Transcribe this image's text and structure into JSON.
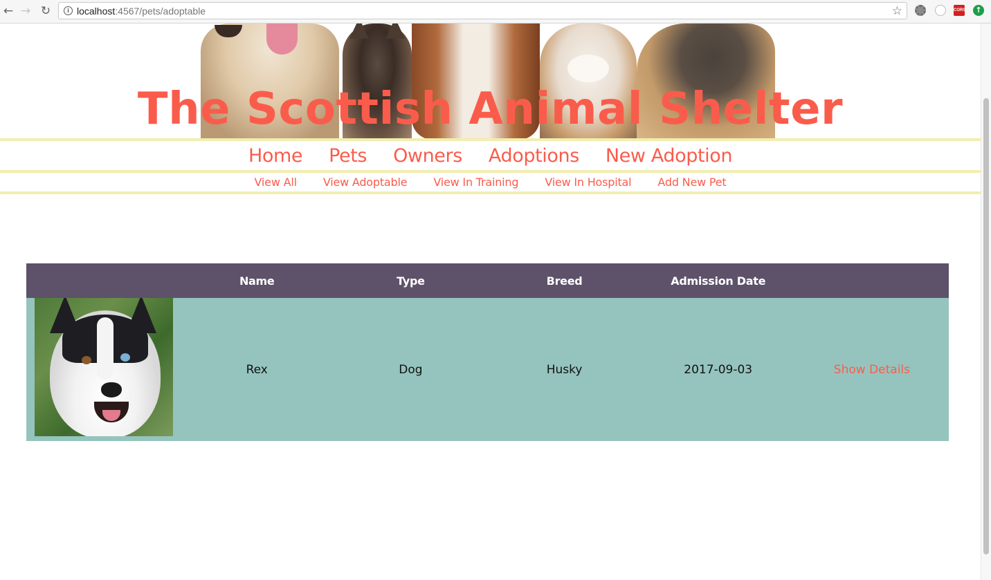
{
  "browser": {
    "url_host": "localhost",
    "url_path": ":4567/pets/adoptable",
    "extensions": [
      "gear-icon",
      "circle-icon",
      "cors-icon",
      "update-icon"
    ],
    "cors_label": "CORS"
  },
  "header": {
    "title": "The Scottish Animal Shelter"
  },
  "main_nav": {
    "items": [
      "Home",
      "Pets",
      "Owners",
      "Adoptions",
      "New Adoption"
    ]
  },
  "sub_nav": {
    "items": [
      "View All",
      "View Adoptable",
      "View In Training",
      "View In Hospital",
      "Add New Pet"
    ]
  },
  "table": {
    "headers": [
      "",
      "Name",
      "Type",
      "Breed",
      "Admission Date",
      ""
    ],
    "rows": [
      {
        "name": "Rex",
        "type": "Dog",
        "breed": "Husky",
        "admission_date": "2017-09-03",
        "action": "Show Details"
      }
    ]
  },
  "colors": {
    "accent": "#fa5c4c",
    "nav_line": "#f2eeae",
    "table_header": "#5d5269",
    "table_row": "#95c4be"
  }
}
